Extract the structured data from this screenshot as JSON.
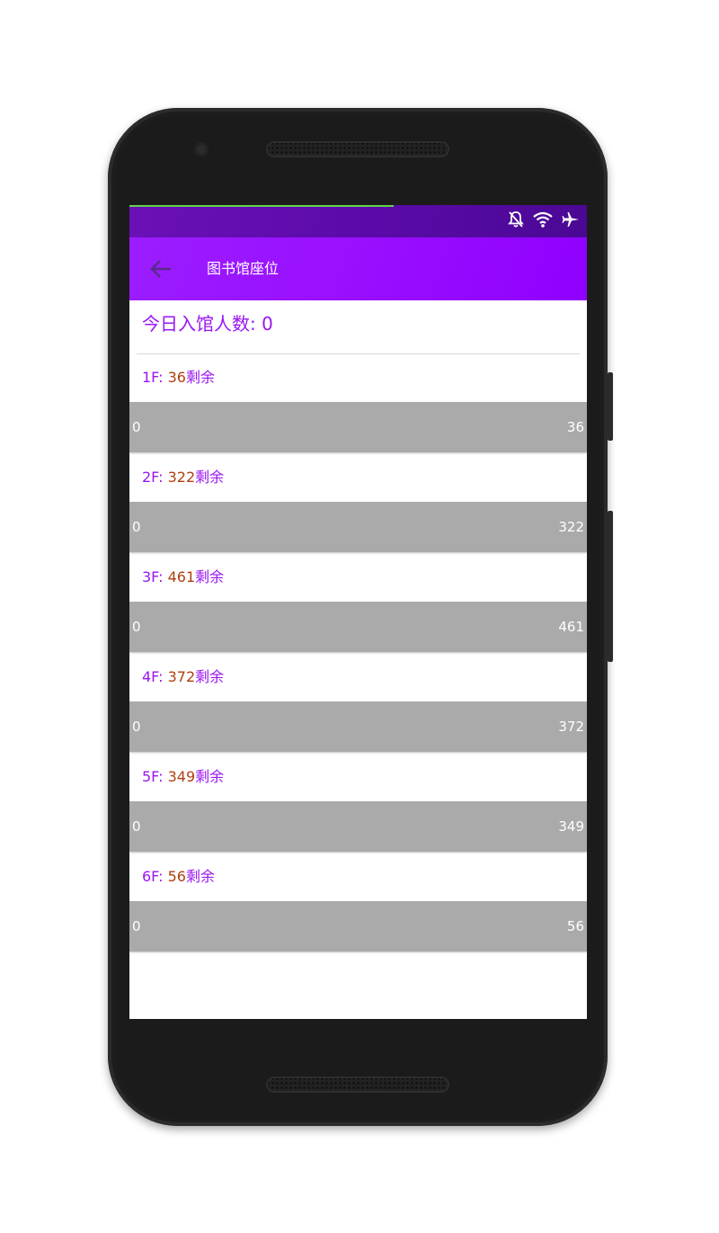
{
  "status_bar": {
    "icons": [
      "notifications-off-icon",
      "wifi-icon",
      "airplane-icon"
    ]
  },
  "toolbar": {
    "title": "图书馆座位",
    "back_icon": "arrow-back-icon"
  },
  "today_count_label": "今日入馆人数: 0",
  "floors": [
    {
      "name": "1F: ",
      "remaining": "36",
      "suffix": "剩余",
      "min": "0",
      "max": "36"
    },
    {
      "name": "2F: ",
      "remaining": "322",
      "suffix": "剩余",
      "min": "0",
      "max": "322"
    },
    {
      "name": "3F: ",
      "remaining": "461",
      "suffix": "剩余",
      "min": "0",
      "max": "461"
    },
    {
      "name": "4F: ",
      "remaining": "372",
      "suffix": "剩余",
      "min": "0",
      "max": "372"
    },
    {
      "name": "5F: ",
      "remaining": "349",
      "suffix": "剩余",
      "min": "0",
      "max": "349"
    },
    {
      "name": "6F: ",
      "remaining": "56",
      "suffix": "剩余",
      "min": "0",
      "max": "56"
    }
  ],
  "colors": {
    "toolbar": "#9a10ff",
    "status_bar": "#5a0aa8",
    "label_purple": "#9a16f2",
    "number_orange": "#b04010",
    "bar_gray": "#aaaaaa"
  }
}
